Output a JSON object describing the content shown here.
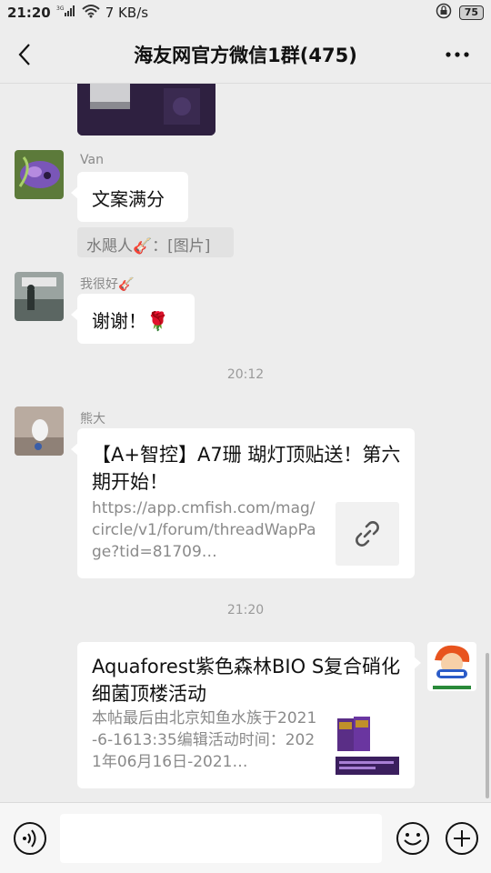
{
  "status_bar": {
    "time": "21:20",
    "network": "3G",
    "speed": "7 KB/s",
    "battery": "75",
    "icons": [
      "signal-icon",
      "wifi-icon",
      "lock-icon",
      "battery-icon"
    ]
  },
  "header": {
    "title": "海友网官方微信1群(475)",
    "back_icon": "back-arrow-icon",
    "more_icon": "more-dots-icon"
  },
  "messages": [
    {
      "type": "image",
      "sender": "",
      "image_icon": "photo-thumbnail"
    },
    {
      "type": "text",
      "sender": "Van",
      "text": "文案满分",
      "quote": "水飓人🎸：[图片]"
    },
    {
      "type": "text",
      "sender": "我很好🎸",
      "text": "谢谢！🌹"
    },
    {
      "type": "timestamp",
      "text": "20:12"
    },
    {
      "type": "link",
      "sender": "熊大",
      "title": "【A+智控】A7珊 瑚灯顶贴送！第六期开始！",
      "desc": "https://app.cmfish.com/mag/circle/v1/forum/threadWapPage?tid=81709…",
      "thumb_icon": "link-icon"
    },
    {
      "type": "timestamp",
      "text": "21:20"
    },
    {
      "type": "link",
      "sender": "",
      "title": "Aquaforest紫色森林BIO S复合硝化细菌顶楼活动",
      "desc": "本帖最后由北京知鱼水族于2021-6-1613:35编辑活动时间：2021年06月16日-2021…",
      "thumb_icon": "product-thumbnail"
    }
  ],
  "input_bar": {
    "placeholder": "",
    "voice_icon": "voice-icon",
    "emoji_icon": "emoji-icon",
    "plus_icon": "plus-icon"
  },
  "colors": {
    "background": "#ededed",
    "bubble": "#ffffff",
    "text": "#111111",
    "muted": "#8a8a8a"
  }
}
